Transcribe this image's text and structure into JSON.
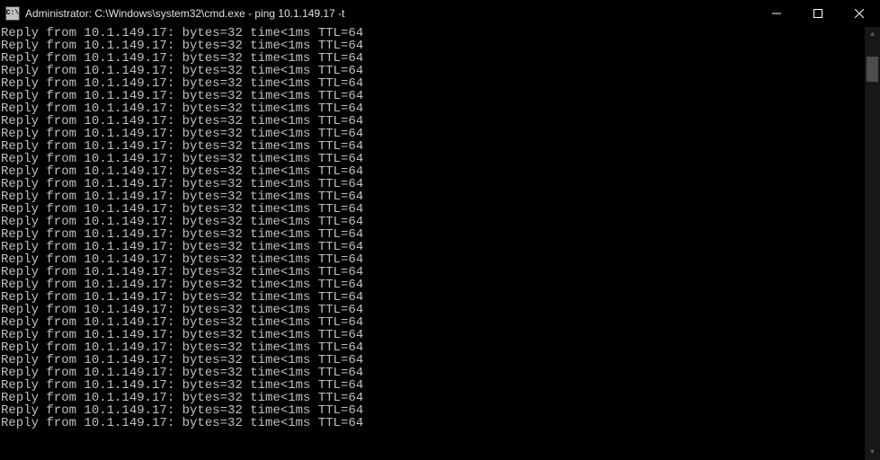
{
  "window": {
    "title": "Administrator: C:\\Windows\\system32\\cmd.exe - ping  10.1.149.17 -t",
    "icon_glyph": "C:\\"
  },
  "ping": {
    "ip": "10.1.149.17",
    "bytes": 32,
    "time": "<1ms",
    "ttl": 64,
    "line_template": "Reply from 10.1.149.17: bytes=32 time<1ms TTL=64",
    "visible_line_count": 32
  }
}
